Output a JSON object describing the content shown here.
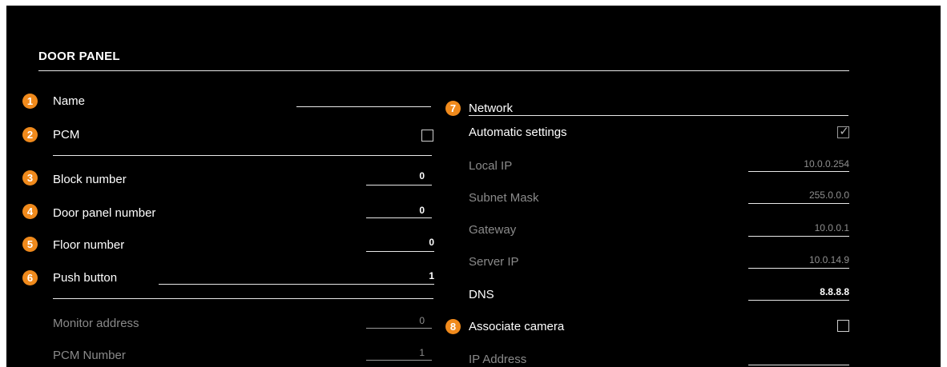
{
  "title": "DOOR PANEL",
  "colors": {
    "background": "#000000",
    "badge": "#f08a1c",
    "text": "#ffffff",
    "disabled_text": "#8a8a8a"
  },
  "left": {
    "name": {
      "badge": "1",
      "label": "Name",
      "value": ""
    },
    "pcm": {
      "badge": "2",
      "label": "PCM",
      "checked": false
    },
    "block_number": {
      "badge": "3",
      "label": "Block number",
      "value": "0"
    },
    "door_panel_number": {
      "badge": "4",
      "label": "Door panel number",
      "value": "0"
    },
    "floor_number": {
      "badge": "5",
      "label": "Floor number",
      "value": "0"
    },
    "push_button": {
      "badge": "6",
      "label": "Push button",
      "value": "1"
    },
    "monitor_address": {
      "label": "Monitor address",
      "value": "0"
    },
    "pcm_number": {
      "label": "PCM Number",
      "value": "1"
    }
  },
  "right": {
    "network": {
      "badge": "7",
      "label": "Network"
    },
    "automatic_settings": {
      "label": "Automatic settings",
      "checked": true
    },
    "local_ip": {
      "label": "Local IP",
      "value": "10.0.0.254"
    },
    "subnet_mask": {
      "label": "Subnet Mask",
      "value": "255.0.0.0"
    },
    "gateway": {
      "label": "Gateway",
      "value": "10.0.0.1"
    },
    "server_ip": {
      "label": "Server IP",
      "value": "10.0.14.9"
    },
    "dns": {
      "label": "DNS",
      "value": "8.8.8.8"
    },
    "associate_camera": {
      "badge": "8",
      "label": "Associate camera",
      "checked": false
    },
    "ip_address": {
      "label": "IP Address",
      "value": ""
    }
  }
}
